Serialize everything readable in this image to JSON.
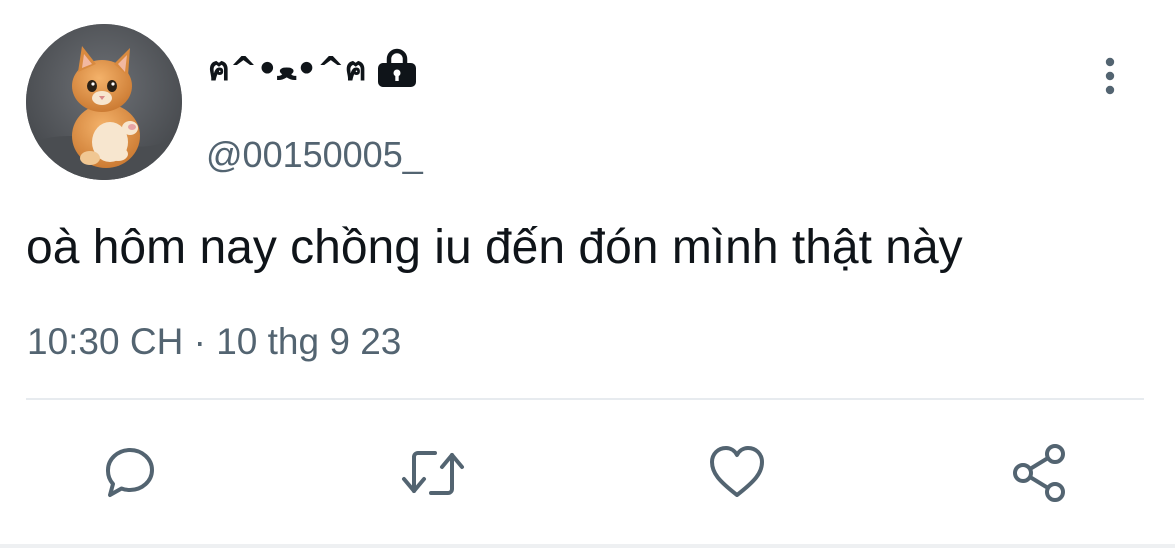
{
  "tweet": {
    "display_name": "ฅ^•ﻌ•^ฅ",
    "username": "@00150005_",
    "text": "oà hôm nay chồng iu đến đón mình thật này",
    "time": "10:30 CH",
    "separator": "·",
    "date": "10 thg 9 23",
    "protected_icon": "lock-icon",
    "avatar": "orange-kitten-photo"
  },
  "actions": [
    {
      "name": "reply",
      "icon": "speech-bubble-icon"
    },
    {
      "name": "retweet",
      "icon": "retweet-arrows-icon"
    },
    {
      "name": "like",
      "icon": "heart-icon"
    },
    {
      "name": "share",
      "icon": "share-nodes-icon"
    }
  ],
  "colors": {
    "text_primary": "#0f1419",
    "text_secondary": "#536471",
    "icon": "#536471",
    "divider": "#e7ebef",
    "background": "#ffffff"
  }
}
